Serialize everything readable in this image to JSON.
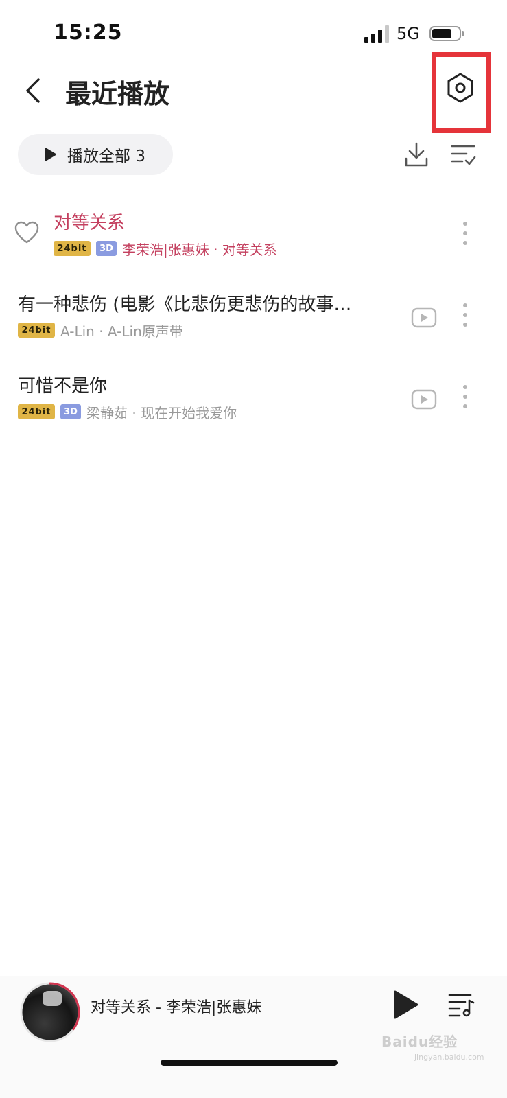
{
  "status_bar": {
    "time": "15:25",
    "network": "5G"
  },
  "header": {
    "title": "最近播放"
  },
  "toolbar": {
    "play_all_label": "播放全部",
    "play_all_count": "3"
  },
  "songs": [
    {
      "title": "对等关系",
      "badges": [
        "24bit",
        "3D"
      ],
      "meta": "李荣浩|张惠妹 · 对等关系",
      "active": true,
      "liked": false
    },
    {
      "title": "有一种悲伤 (电影《比悲伤更悲伤的故事…",
      "badges": [
        "24bit"
      ],
      "meta": "A-Lin · A-Lin原声带",
      "active": false,
      "has_mv": true
    },
    {
      "title": "可惜不是你",
      "badges": [
        "24bit",
        "3D"
      ],
      "meta": "梁静茹 · 现在开始我爱你",
      "active": false,
      "has_mv": true
    }
  ],
  "mini_player": {
    "now_playing": "对等关系 - 李荣浩|张惠妹",
    "playback_progress": 0.35
  },
  "watermark": {
    "text": "Baidu经验",
    "sub": "jingyan.baidu.com"
  },
  "colors": {
    "accent": "#c4405f",
    "highlight_box": "#e5343a",
    "badge_24bit": "#e0b546",
    "badge_3d": "#8a9be0"
  },
  "icons": {
    "back": "chevron-left-icon",
    "settings": "hexagon-gear-icon",
    "play_all": "play-icon",
    "download": "download-icon",
    "multi_select": "list-check-icon",
    "heart": "heart-outline-icon",
    "mv": "video-play-icon",
    "more": "vertical-dots-icon",
    "queue": "playlist-music-icon"
  }
}
